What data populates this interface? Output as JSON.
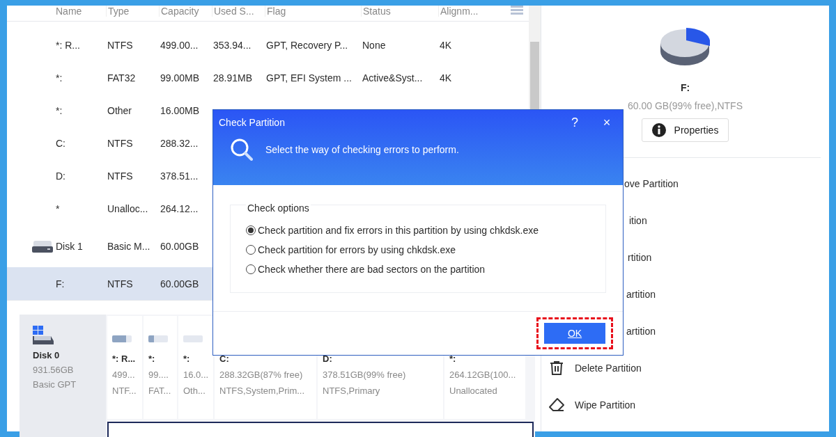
{
  "table": {
    "columns": [
      "Name",
      "Type",
      "Capacity",
      "Used S...",
      "Flag",
      "Status",
      "Alignm..."
    ],
    "rows": [
      {
        "kind": "partition",
        "selected": false,
        "cells": [
          "*: R...",
          "NTFS",
          "499.00...",
          "353.94...",
          "GPT, Recovery P...",
          "None",
          "4K"
        ]
      },
      {
        "kind": "partition",
        "selected": false,
        "cells": [
          "*:",
          "FAT32",
          "99.00MB",
          "28.91MB",
          "GPT, EFI System ...",
          "Active&Syst...",
          "4K"
        ]
      },
      {
        "kind": "partition",
        "selected": false,
        "cells": [
          "*:",
          "Other",
          "16.00MB"
        ]
      },
      {
        "kind": "partition",
        "selected": false,
        "cells": [
          "C:",
          "NTFS",
          "288.32..."
        ]
      },
      {
        "kind": "partition",
        "selected": false,
        "cells": [
          "D:",
          "NTFS",
          "378.51..."
        ]
      },
      {
        "kind": "partition",
        "selected": false,
        "cells": [
          "*",
          "Unalloc...",
          "264.12..."
        ]
      },
      {
        "kind": "disk",
        "selected": false,
        "cells": [
          "Disk 1",
          "Basic M...",
          "60.00GB"
        ]
      },
      {
        "kind": "partition",
        "selected": true,
        "cells": [
          "F:",
          "NTFS",
          "60.00GB"
        ]
      }
    ]
  },
  "disk_map": [
    {
      "name": "Disk 0",
      "size": "931.56GB",
      "style": "Basic GPT",
      "partitions": [
        {
          "selected": false,
          "level": 0.7,
          "label": "*: R...",
          "size": "499...",
          "detail": "NTF..."
        },
        {
          "selected": false,
          "level": 0.3,
          "label": "*:",
          "size": "99....",
          "detail": "FAT..."
        },
        {
          "selected": false,
          "level": 0,
          "label": "*:",
          "size": "16.0...",
          "detail": "Oth..."
        },
        {
          "selected": false,
          "label": "C:",
          "size": "288.32GB(87% free)",
          "detail": "NTFS,System,Prim..."
        },
        {
          "selected": false,
          "label": "D:",
          "size": "378.51GB(99% free)",
          "detail": "NTFS,Primary"
        },
        {
          "selected": false,
          "label": "*:",
          "size": "264.12GB(100...",
          "detail": "Unallocated"
        }
      ]
    },
    {
      "partitions": [
        {
          "selected": true
        }
      ]
    }
  ],
  "details": {
    "name": "F:",
    "summary": "60.00 GB(99% free),NTFS",
    "properties_button": "Properties"
  },
  "actions": [
    {
      "kind": "covered",
      "label": "ove Partition"
    },
    {
      "kind": "covered",
      "label": "ition"
    },
    {
      "kind": "covered",
      "label": "rtition"
    },
    {
      "kind": "covered",
      "label": "artition"
    },
    {
      "kind": "covered",
      "label": "artition"
    },
    {
      "kind": "delete",
      "label": "Delete Partition"
    },
    {
      "kind": "wipe",
      "label": "Wipe Partition"
    }
  ],
  "dialog": {
    "title": "Check Partition",
    "help": "?",
    "close": "×",
    "intro": "Select the way of checking errors to perform.",
    "group_title": "Check options",
    "options": [
      {
        "label": "Check partition and fix errors in this partition by using chkdsk.exe",
        "selected": true
      },
      {
        "label": "Check partition for errors by using chkdsk.exe",
        "selected": false
      },
      {
        "label": "Check whether there are bad sectors on the partition",
        "selected": false
      }
    ],
    "ok_button": {
      "label": "OK",
      "highlighted": true
    }
  }
}
